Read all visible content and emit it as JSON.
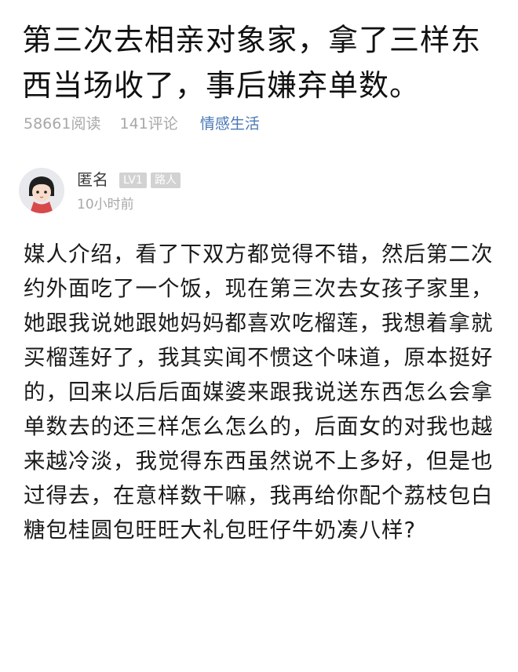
{
  "post": {
    "title": "第三次去相亲对象家，拿了三样东西当场收了，事后嫌弃单数。",
    "views": "58661阅读",
    "comments": "141评论",
    "category": "情感生活"
  },
  "author": {
    "name": "匿名",
    "level": "LV1",
    "role": "路人",
    "time": "10小时前",
    "avatar_icon": "cartoon-girl-avatar"
  },
  "body": "媒人介绍，看了下双方都觉得不错，然后第二次约外面吃了一个饭，现在第三次去女孩子家里，她跟我说她跟她妈妈都喜欢吃榴莲，我想着拿就买榴莲好了，我其实闻不惯这个味道，原本挺好的，回来以后后面媒婆来跟我说送东西怎么会拿单数去的还三样怎么怎么的，后面女的对我也越来越冷淡，我觉得东西虽然说不上多好，但是也过得去，在意样数干嘛，我再给你配个荔枝包白糖包桂圆包旺旺大礼包旺仔牛奶凑八样?"
}
